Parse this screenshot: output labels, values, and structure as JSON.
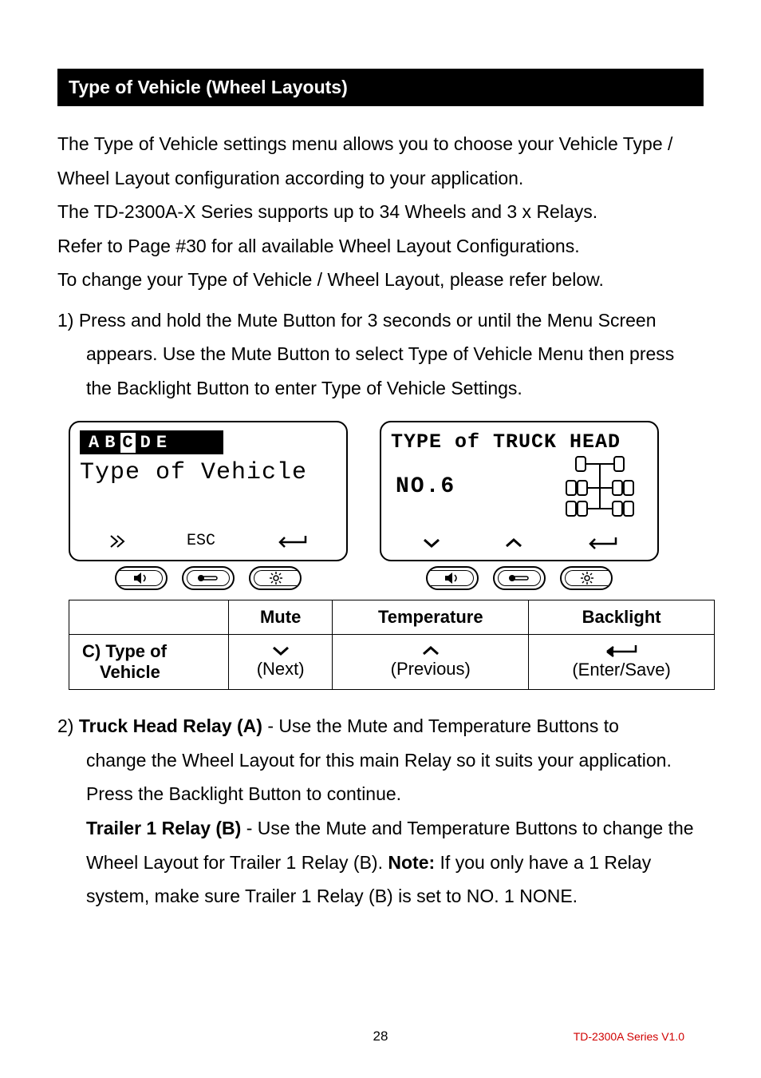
{
  "section_title": "Type of Vehicle (Wheel Layouts)",
  "intro": {
    "line1": "The Type of Vehicle settings menu allows you to choose your Vehicle Type / Wheel Layout configuration according to your application.",
    "line2": "The TD-2300A-X Series supports up to 34 Wheels and 3 x Relays.",
    "line3": "Refer to Page #30 for all available Wheel Layout Configurations.",
    "line4": "To change your Type of Vehicle / Wheel Layout, please refer below."
  },
  "step1": {
    "prefix": "1) ",
    "text": "Press and hold the Mute Button for 3 seconds or until the Menu Screen appears. Use the Mute Button to select Type of Vehicle Menu then press the Backlight Button to enter Type of Vehicle Settings."
  },
  "lcd1": {
    "tabs": [
      "A",
      "B",
      "C",
      "D",
      "E"
    ],
    "selected_tab": "C",
    "title": "Type of Vehicle",
    "bottom_mid": "ESC"
  },
  "lcd2": {
    "heading": "TYPE of TRUCK HEAD",
    "number_label": "NO.6"
  },
  "button_names": {
    "mute": "mute-icon",
    "temp": "thermometer-icon",
    "backlight": "brightness-icon"
  },
  "table": {
    "headers": [
      "",
      "Mute",
      "Temperature",
      "Backlight"
    ],
    "row_label_line1": "C) Type of",
    "row_label_line2": "Vehicle",
    "mute_caption": "(Next)",
    "temp_caption": "(Previous)",
    "backlight_caption": "(Enter/Save)"
  },
  "step2": {
    "prefix": "2) ",
    "relayA_bold": "Truck Head Relay (A)",
    "relayA_text": " - Use the Mute and Temperature Buttons to change the Wheel Layout for this main Relay so it suits your application. Press the Backlight Button to continue.",
    "relayB_bold": "Trailer 1 Relay (B)",
    "relayB_text_1": " - Use the Mute and Temperature Buttons to change the Wheel Layout for Trailer 1 Relay (B). ",
    "note_bold": "Note:",
    "relayB_text_2": " If you only have a 1 Relay system, make sure Trailer 1 Relay (B) is set to NO. 1  NONE."
  },
  "footer": {
    "page": "28",
    "version": "TD-2300A Series V1.0"
  }
}
